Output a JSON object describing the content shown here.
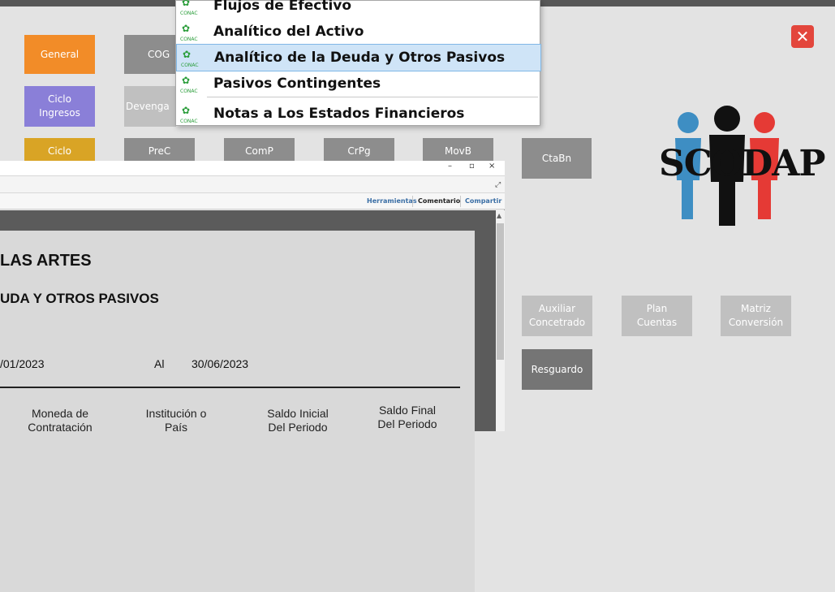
{
  "tiles": {
    "general": "General",
    "cog": "COG",
    "ciclo_ingresos": "Ciclo\nIngresos",
    "devenga": "Devenga",
    "ciclo": "Ciclo",
    "prec": "PreC",
    "comp": "ComP",
    "crpg": "CrPg",
    "movb": "MovB",
    "ctabn": "CtaBn",
    "auxiliar": "Auxiliar\nConcetrado",
    "plan": "Plan\nCuentas",
    "matriz": "Matriz\nConversión",
    "resguardo": "Resguardo"
  },
  "menu": {
    "icon_caption": "CONAC",
    "items": [
      {
        "label": "Flujos de Efectivo"
      },
      {
        "label": "Analítico del Activo"
      },
      {
        "label": "Analítico de la Deuda y Otros Pasivos"
      },
      {
        "label": "Pasivos Contingentes"
      },
      {
        "label": "Notas a Los Estados Financieros"
      }
    ]
  },
  "close_label": "✕",
  "logo": {
    "text": "SCODAP"
  },
  "doc": {
    "toolbar": {
      "herramientas": "Herramientas",
      "comentario": "Comentario",
      "compartir": "Compartir"
    },
    "title1": "LAS ARTES",
    "title2": "UDA Y OTROS PASIVOS",
    "date_from": "/01/2023",
    "al": "Al",
    "date_to": "30/06/2023",
    "columns": {
      "moneda": "Moneda de\nContratación",
      "institucion": "Institución o\nPaís",
      "saldo_inicial": "Saldo Inicial\nDel Periodo",
      "saldo_final": "Saldo Final\nDel Periodo"
    }
  },
  "colors": {
    "orange": "#f28c28",
    "purple": "#8a7fd8",
    "yellow": "#d9a425",
    "gray_tile": "#8d8d8d",
    "light_tile": "#c0c0c0",
    "dark_tile": "#757575",
    "close_red": "#e3463c",
    "menu_selected": "#cfe4f7",
    "figure_blue": "#3e8ec3",
    "figure_black": "#111111",
    "figure_red": "#e53a35"
  }
}
